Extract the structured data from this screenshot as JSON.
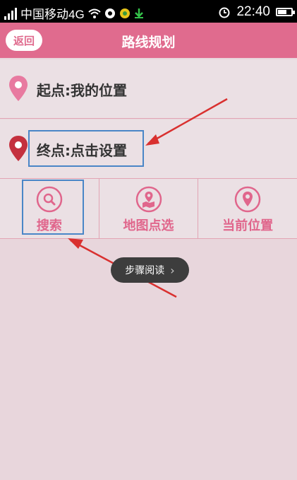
{
  "status_bar": {
    "carrier": "中国移动4G",
    "time": "22:40"
  },
  "header": {
    "back_label": "返回",
    "title": "路线规划"
  },
  "route": {
    "start_label": "起点:我的位置",
    "end_label": "终点:点击设置"
  },
  "actions": {
    "search": "搜索",
    "map_pick": "地图点选",
    "current_location": "当前位置"
  },
  "toast": {
    "text": "步骤阅读",
    "chevron": "›"
  },
  "colors": {
    "accent": "#e06b8e",
    "background": "#e8d6dc",
    "highlight_box": "#4a86c7",
    "arrow": "#d9302f"
  }
}
